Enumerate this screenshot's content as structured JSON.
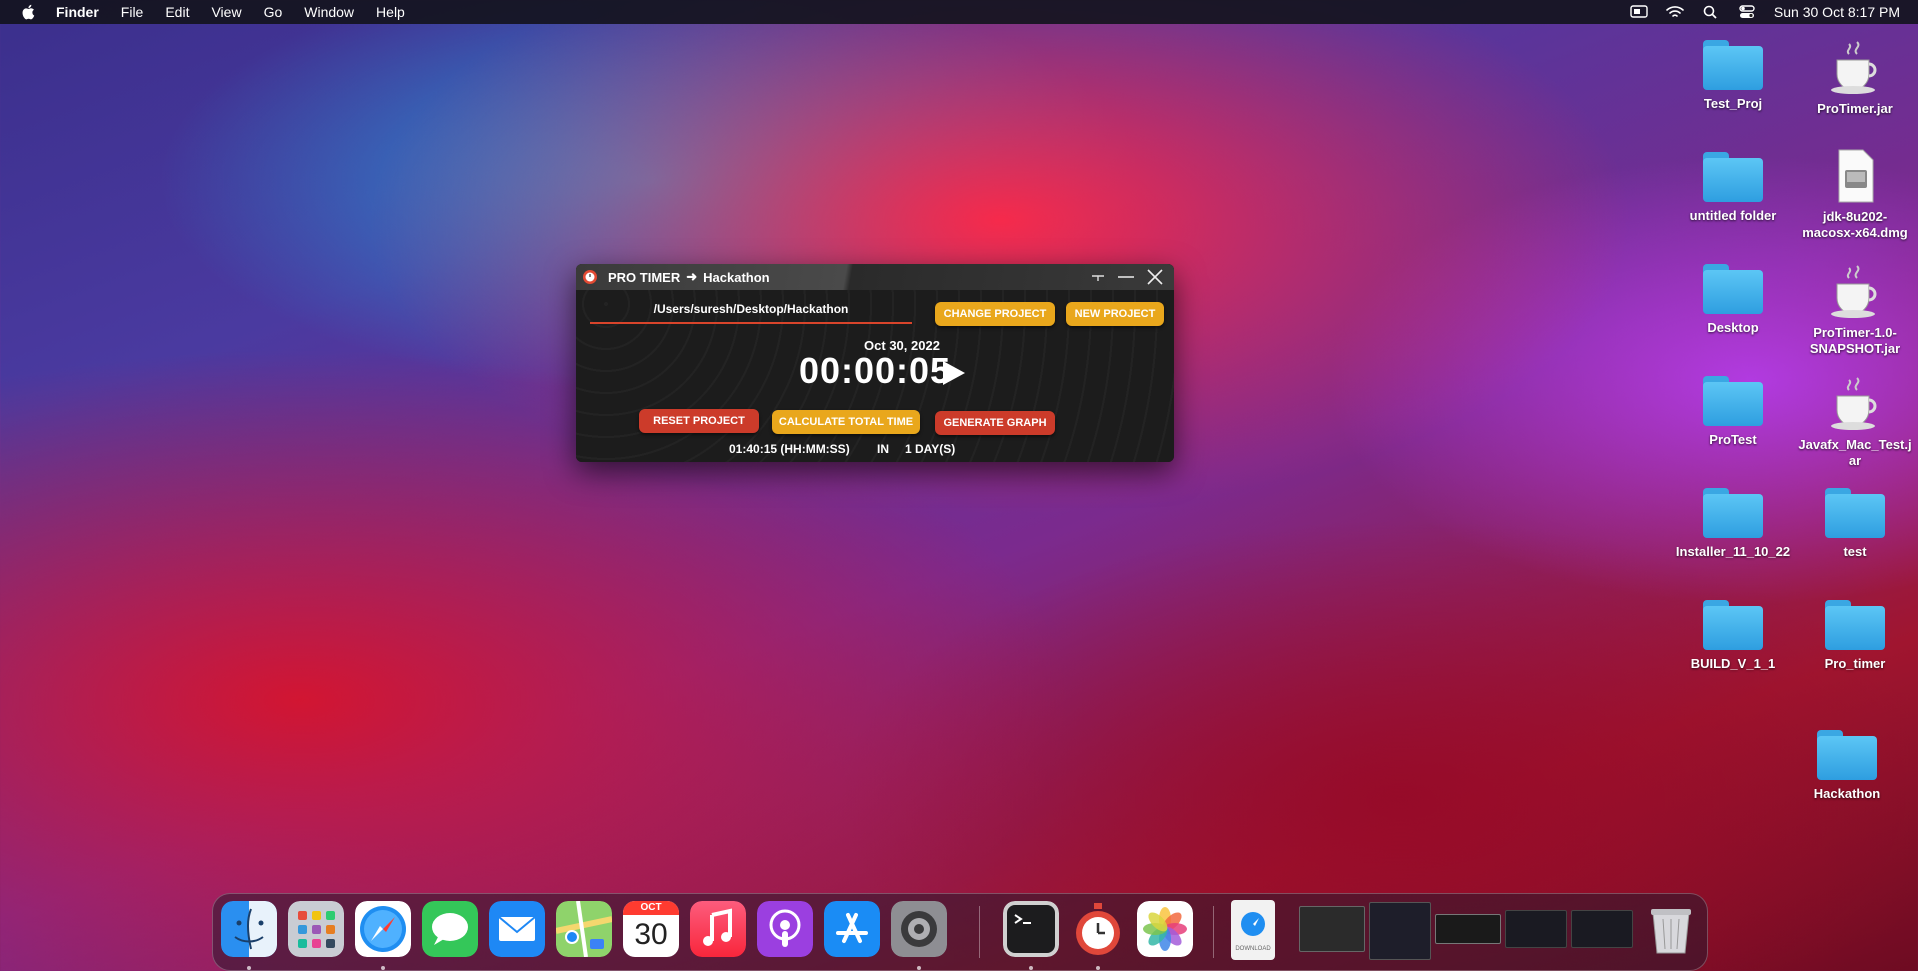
{
  "menubar": {
    "app_name": "Finder",
    "items": [
      "File",
      "Edit",
      "View",
      "Go",
      "Window",
      "Help"
    ],
    "clock": "Sun 30 Oct  8:17 PM"
  },
  "desktop": {
    "icons": [
      {
        "label": "Test_Proj",
        "kind": "folder"
      },
      {
        "label": "ProTimer.jar",
        "kind": "jar"
      },
      {
        "label": "untitled folder",
        "kind": "folder"
      },
      {
        "label": "jdk-8u202-\nmacosx-x64.dmg",
        "kind": "dmg"
      },
      {
        "label": "Desktop",
        "kind": "folder"
      },
      {
        "label": "ProTimer-1.0-\nSNAPSHOT.jar",
        "kind": "jar"
      },
      {
        "label": "ProTest",
        "kind": "folder"
      },
      {
        "label": "Javafx_Mac_Test.j\nar",
        "kind": "jar"
      },
      {
        "label": "Installer_11_10_22",
        "kind": "folder"
      },
      {
        "label": "test",
        "kind": "folder"
      },
      {
        "label": "BUILD_V_1_1",
        "kind": "folder"
      },
      {
        "label": "Pro_timer",
        "kind": "folder"
      },
      {
        "label": "Hackathon",
        "kind": "folder"
      }
    ]
  },
  "window": {
    "title_app": "PRO TIMER",
    "title_arrow": "➜",
    "title_project": "Hackathon",
    "path": "/Users/suresh/Desktop/Hackathon",
    "change_project_label": "CHANGE PROJECT",
    "new_project_label": "NEW PROJECT",
    "date": "Oct 30, 2022",
    "timer": "00:00:05",
    "reset_label": "RESET PROJECT",
    "calculate_label": "CALCULATE TOTAL TIME",
    "graph_label": "GENERATE GRAPH",
    "total_time": "01:40:15 (HH:MM:SS)",
    "in_label": "IN",
    "days": "1 DAY(S)"
  },
  "dock": {
    "calendar_month": "OCT",
    "calendar_day": "30",
    "apps": [
      "finder-icon",
      "launchpad-icon",
      "safari-icon",
      "messages-icon",
      "mail-icon",
      "maps-icon",
      "calendar-icon",
      "music-icon",
      "podcasts-icon",
      "app-store-icon",
      "system-preferences-icon",
      "terminal-icon",
      "protimer-icon",
      "photos-icon",
      "downloads-stack-icon",
      "trash-icon"
    ],
    "download_label": "DOWNLOAD"
  },
  "colors": {
    "accent_yellow": "#e9a71c",
    "accent_red": "#cc3b2a"
  }
}
